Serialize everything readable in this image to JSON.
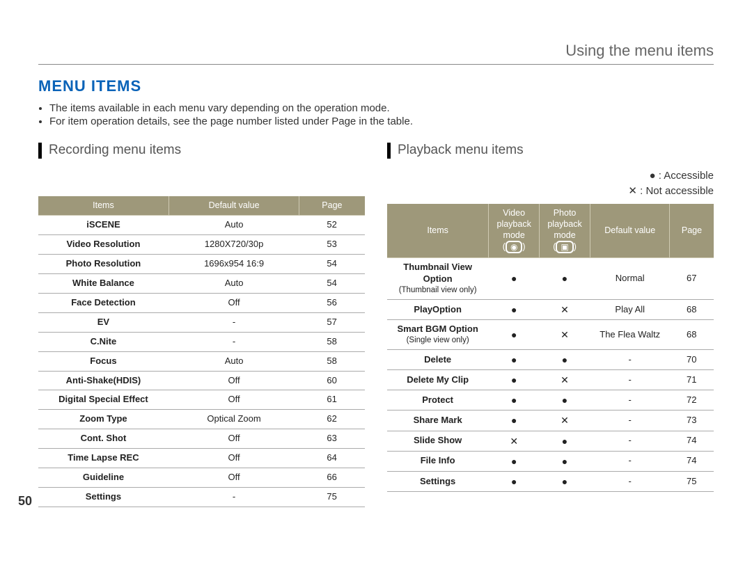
{
  "breadcrumb": "Using the menu items",
  "section_title": "MENU ITEMS",
  "bullets": [
    "The items available in each menu vary depending on the operation mode.",
    "For item operation details, see the page number listed under Page in the table."
  ],
  "page_number": "50",
  "legend": {
    "accessible_symbol": "●",
    "accessible_label": ": Accessible",
    "not_accessible_symbol": "✕",
    "not_accessible_label": ": Not accessible"
  },
  "recording": {
    "title": "Recording menu items",
    "headers": {
      "c0": "Items",
      "c1": "Default value",
      "c2": "Page"
    },
    "rows": [
      {
        "item": "iSCENE",
        "default": "Auto",
        "page": "52"
      },
      {
        "item": "Video Resolution",
        "default": "1280X720/30p",
        "page": "53"
      },
      {
        "item": "Photo Resolution",
        "default": "1696x954 16:9",
        "page": "54"
      },
      {
        "item": "White Balance",
        "default": "Auto",
        "page": "54"
      },
      {
        "item": "Face Detection",
        "default": "Off",
        "page": "56"
      },
      {
        "item": "EV",
        "default": "-",
        "page": "57"
      },
      {
        "item": "C.Nite",
        "default": "-",
        "page": "58"
      },
      {
        "item": "Focus",
        "default": "Auto",
        "page": "58"
      },
      {
        "item": "Anti-Shake(HDIS)",
        "default": "Off",
        "page": "60"
      },
      {
        "item": "Digital Special Effect",
        "default": "Off",
        "page": "61"
      },
      {
        "item": "Zoom Type",
        "default": "Optical Zoom",
        "page": "62"
      },
      {
        "item": "Cont. Shot",
        "default": "Off",
        "page": "63"
      },
      {
        "item": "Time Lapse REC",
        "default": "Off",
        "page": "64"
      },
      {
        "item": "Guideline",
        "default": "Off",
        "page": "66"
      },
      {
        "item": "Settings",
        "default": "-",
        "page": "75"
      }
    ]
  },
  "playback": {
    "title": "Playback menu items",
    "headers": {
      "c0": "Items",
      "c1a": "Video",
      "c1b": "playback",
      "c1c": "mode",
      "c1icon": "◉",
      "c2a": "Photo",
      "c2b": "playback",
      "c2c": "mode",
      "c2icon": "▣",
      "c3": "Default value",
      "c4": "Page"
    },
    "rows": [
      {
        "item": "Thumbnail View Option",
        "sub": "(Thumbnail view only)",
        "video": "●",
        "photo": "●",
        "default": "Normal",
        "page": "67"
      },
      {
        "item": "PlayOption",
        "sub": "",
        "video": "●",
        "photo": "✕",
        "default": "Play All",
        "page": "68"
      },
      {
        "item": "Smart BGM Option",
        "sub": "(Single view only)",
        "video": "●",
        "photo": "✕",
        "default": "The Flea Waltz",
        "page": "68"
      },
      {
        "item": "Delete",
        "sub": "",
        "video": "●",
        "photo": "●",
        "default": "-",
        "page": "70"
      },
      {
        "item": "Delete My Clip",
        "sub": "",
        "video": "●",
        "photo": "✕",
        "default": "-",
        "page": "71"
      },
      {
        "item": "Protect",
        "sub": "",
        "video": "●",
        "photo": "●",
        "default": "-",
        "page": "72"
      },
      {
        "item": "Share Mark",
        "sub": "",
        "video": "●",
        "photo": "✕",
        "default": "-",
        "page": "73"
      },
      {
        "item": "Slide Show",
        "sub": "",
        "video": "✕",
        "photo": "●",
        "default": "-",
        "page": "74"
      },
      {
        "item": "File Info",
        "sub": "",
        "video": "●",
        "photo": "●",
        "default": "-",
        "page": "74"
      },
      {
        "item": "Settings",
        "sub": "",
        "video": "●",
        "photo": "●",
        "default": "-",
        "page": "75"
      }
    ]
  }
}
